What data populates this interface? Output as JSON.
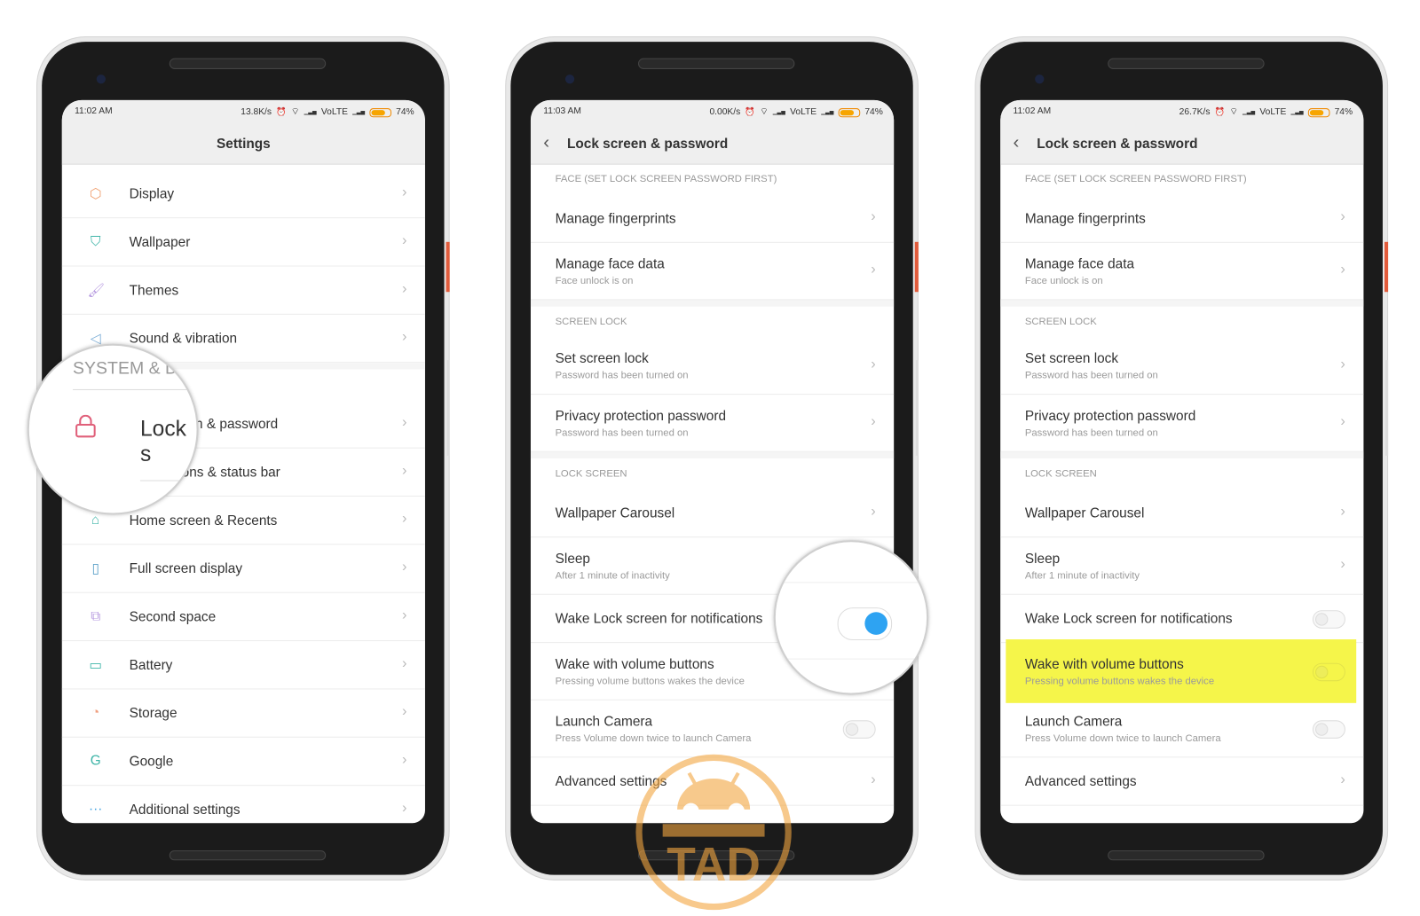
{
  "phones": [
    {
      "status": {
        "time": "11:02 AM",
        "speed": "13.8K/s",
        "network": "VoLTE",
        "battery": "74%",
        "battery_level": 0.74
      },
      "header": {
        "title": "Settings",
        "back": false
      },
      "rows": [
        {
          "type": "item",
          "icon": "display-icon",
          "glyph": "⬡",
          "color": "#f0a070",
          "title": "Display"
        },
        {
          "type": "item",
          "icon": "wallpaper-icon",
          "glyph": "⛉",
          "color": "#3fb5a8",
          "title": "Wallpaper"
        },
        {
          "type": "item",
          "icon": "themes-icon",
          "glyph": "🖌",
          "color": "#b79be0",
          "title": "Themes"
        },
        {
          "type": "item",
          "icon": "sound-icon",
          "glyph": "◁",
          "color": "#7fb0d8",
          "title": "Sound & vibration"
        },
        {
          "type": "gap"
        },
        {
          "type": "section",
          "label": ""
        },
        {
          "type": "item",
          "icon": "lock-icon",
          "glyph": "",
          "color": "#e0607a",
          "title": "Lock screen & password"
        },
        {
          "type": "item",
          "icon": "notifications-icon",
          "glyph": "",
          "color": "#3fa0e0",
          "title": "Notifications & status bar"
        },
        {
          "type": "item",
          "icon": "home-icon",
          "glyph": "⌂",
          "color": "#3fb5a8",
          "title": "Home screen & Recents"
        },
        {
          "type": "item",
          "icon": "full-screen-icon",
          "glyph": "▯",
          "color": "#5aa0c8",
          "title": "Full screen display"
        },
        {
          "type": "item",
          "icon": "second-space-icon",
          "glyph": "⧉",
          "color": "#b79be0",
          "title": "Second space"
        },
        {
          "type": "item",
          "icon": "battery-icon",
          "glyph": "▭",
          "color": "#3fb5a8",
          "title": "Battery"
        },
        {
          "type": "item",
          "icon": "storage-icon",
          "glyph": "◔",
          "color": "#f0a080",
          "title": "Storage"
        },
        {
          "type": "item",
          "icon": "google-icon",
          "glyph": "G",
          "color": "#3fb5a8",
          "title": "Google"
        },
        {
          "type": "item",
          "icon": "more-icon",
          "glyph": "···",
          "color": "#3fa0e0",
          "title": "Additional settings"
        }
      ],
      "magnifier": {
        "section": "SYSTEM & DE",
        "lock_text": "Lock s"
      }
    },
    {
      "status": {
        "time": "11:03 AM",
        "speed": "0.00K/s",
        "network": "VoLTE",
        "battery": "74%",
        "battery_level": 0.74
      },
      "header": {
        "title": "Lock screen & password",
        "back": true
      },
      "rows": [
        {
          "type": "section",
          "label": "FACE (SET LOCK SCREEN PASSWORD FIRST)"
        },
        {
          "type": "item",
          "title": "Manage fingerprints",
          "control": "chevron"
        },
        {
          "type": "item",
          "title": "Manage face data",
          "sub": "Face unlock is on",
          "control": "chevron"
        },
        {
          "type": "gap"
        },
        {
          "type": "section",
          "label": "SCREEN LOCK"
        },
        {
          "type": "item",
          "title": "Set screen lock",
          "sub": "Password has been turned on",
          "control": "chevron"
        },
        {
          "type": "item",
          "title": "Privacy protection password",
          "sub": "Password has been turned on",
          "control": "chevron"
        },
        {
          "type": "gap"
        },
        {
          "type": "section",
          "label": "LOCK SCREEN"
        },
        {
          "type": "item",
          "title": "Wallpaper Carousel",
          "control": "chevron"
        },
        {
          "type": "item",
          "title": "Sleep",
          "sub": "After 1 minute of inactivity",
          "control": "chevron"
        },
        {
          "type": "item",
          "title": "Wake Lock screen for notifications",
          "control": "toggle",
          "on": true
        },
        {
          "type": "item",
          "title": "Wake with volume buttons",
          "sub": "Pressing volume buttons wakes the device",
          "control": "toggle",
          "on": false
        },
        {
          "type": "item",
          "title": "Launch Camera",
          "sub": "Press Volume down twice to launch Camera",
          "control": "toggle",
          "on": false
        },
        {
          "type": "item",
          "title": "Advanced settings",
          "control": "chevron"
        }
      ],
      "toggle_on_color": "#2ea3f2"
    },
    {
      "status": {
        "time": "11:02 AM",
        "speed": "26.7K/s",
        "network": "VoLTE",
        "battery": "74%",
        "battery_level": 0.74
      },
      "header": {
        "title": "Lock screen & password",
        "back": true
      },
      "rows": [
        {
          "type": "section",
          "label": "FACE (SET LOCK SCREEN PASSWORD FIRST)"
        },
        {
          "type": "item",
          "title": "Manage fingerprints",
          "control": "chevron"
        },
        {
          "type": "item",
          "title": "Manage face data",
          "sub": "Face unlock is on",
          "control": "chevron"
        },
        {
          "type": "gap"
        },
        {
          "type": "section",
          "label": "SCREEN LOCK"
        },
        {
          "type": "item",
          "title": "Set screen lock",
          "sub": "Password has been turned on",
          "control": "chevron"
        },
        {
          "type": "item",
          "title": "Privacy protection password",
          "sub": "Password has been turned on",
          "control": "chevron"
        },
        {
          "type": "gap"
        },
        {
          "type": "section",
          "label": "LOCK SCREEN"
        },
        {
          "type": "item",
          "title": "Wallpaper Carousel",
          "control": "chevron"
        },
        {
          "type": "item",
          "title": "Sleep",
          "sub": "After 1 minute of inactivity",
          "control": "chevron"
        },
        {
          "type": "item",
          "title": "Wake Lock screen for notifications",
          "control": "toggle",
          "on": false
        },
        {
          "type": "item",
          "title": "Wake with volume buttons",
          "sub": "Pressing volume buttons wakes the device",
          "control": "toggle",
          "on": false,
          "highlighted": true
        },
        {
          "type": "item",
          "title": "Launch Camera",
          "sub": "Press Volume down twice to launch Camera",
          "control": "toggle",
          "on": false
        },
        {
          "type": "item",
          "title": "Advanced settings",
          "control": "chevron"
        }
      ],
      "highlight_color": "#f5f54a"
    }
  ],
  "watermark": {
    "text": "TAD",
    "color": "#f3a640"
  }
}
